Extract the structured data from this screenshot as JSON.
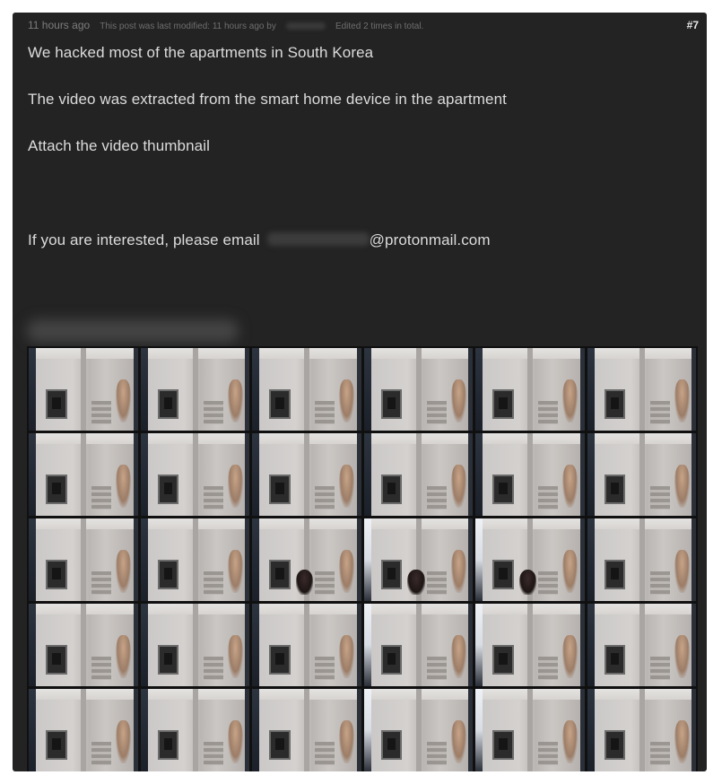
{
  "post": {
    "time": "11 hours ago",
    "modified_text": "This post was last modified: 11 hours ago by",
    "edited_text": "Edited 2 times in total.",
    "number": "#7",
    "lines": [
      "We hacked most of the apartments in South Korea",
      "The video was extracted from the smart home device in the apartment",
      "Attach the video thumbnail"
    ],
    "email_prefix": "If you are interested, please email",
    "email_domain": "@protonmail.com"
  },
  "thumbnail_grid": {
    "columns": 6,
    "rows": 5,
    "person_tiles": [
      14,
      15,
      16
    ],
    "light_tiles": [
      15,
      16,
      21,
      22,
      27,
      28
    ]
  }
}
